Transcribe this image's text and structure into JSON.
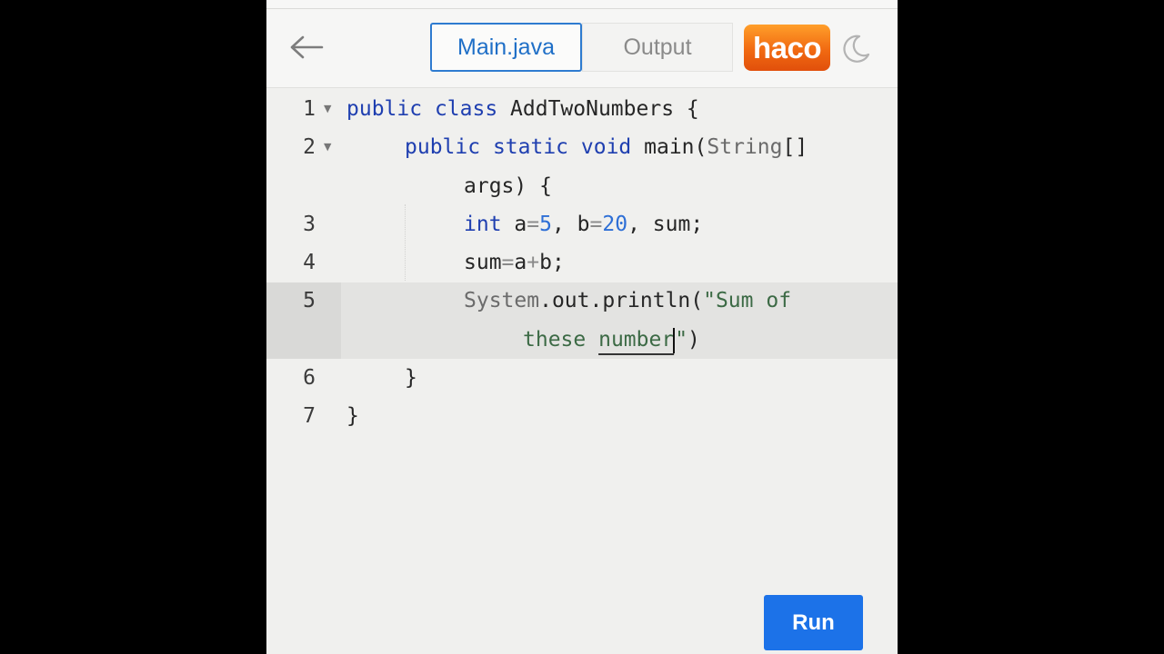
{
  "header": {
    "tabs": [
      {
        "label": "Main.java",
        "active": true
      },
      {
        "label": "Output",
        "active": false
      }
    ],
    "logo_text": "haco",
    "icons": {
      "back": "arrow-left-icon",
      "theme": "moon-icon"
    }
  },
  "editor": {
    "line_numbers": [
      "1",
      "2",
      "3",
      "4",
      "5",
      "6",
      "7"
    ],
    "lines": [
      [
        {
          "t": "public ",
          "c": "kw"
        },
        {
          "t": "class ",
          "c": "kw"
        },
        {
          "t": "AddTwoNumbers {",
          "c": "id"
        }
      ],
      [
        {
          "t": "public ",
          "c": "kw"
        },
        {
          "t": "static ",
          "c": "kw"
        },
        {
          "t": "void ",
          "c": "kw"
        },
        {
          "t": "main(",
          "c": "id"
        },
        {
          "t": "String",
          "c": "sys"
        },
        {
          "t": "[]",
          "c": "id"
        }
      ],
      [
        {
          "t": "args) {",
          "c": "id"
        }
      ],
      [
        {
          "t": "int ",
          "c": "kw"
        },
        {
          "t": "a",
          "c": "id"
        },
        {
          "t": "=",
          "c": "op"
        },
        {
          "t": "5",
          "c": "num"
        },
        {
          "t": ", b",
          "c": "id"
        },
        {
          "t": "=",
          "c": "op"
        },
        {
          "t": "20",
          "c": "num"
        },
        {
          "t": ", sum;",
          "c": "id"
        }
      ],
      [
        {
          "t": "sum",
          "c": "id"
        },
        {
          "t": "=",
          "c": "op"
        },
        {
          "t": "a",
          "c": "id"
        },
        {
          "t": "+",
          "c": "op"
        },
        {
          "t": "b;",
          "c": "id"
        }
      ],
      [
        {
          "t": "System",
          "c": "sys"
        },
        {
          "t": ".out.println(",
          "c": "id"
        },
        {
          "t": "\"Sum of",
          "c": "str"
        }
      ],
      [
        {
          "t": "these ",
          "c": "str"
        },
        {
          "t": "number",
          "c": "str underline"
        },
        {
          "t": "\"",
          "c": "str"
        },
        {
          "t": ")",
          "c": "id"
        }
      ],
      [
        {
          "t": "}",
          "c": "id"
        }
      ],
      [
        {
          "t": "}",
          "c": "id"
        }
      ]
    ],
    "cursor_line": "5"
  },
  "run_button": {
    "label": "Run"
  },
  "colors": {
    "accent": "#1c72e8",
    "tab_active": "#2e7bd0",
    "logo": "#f16a12"
  }
}
